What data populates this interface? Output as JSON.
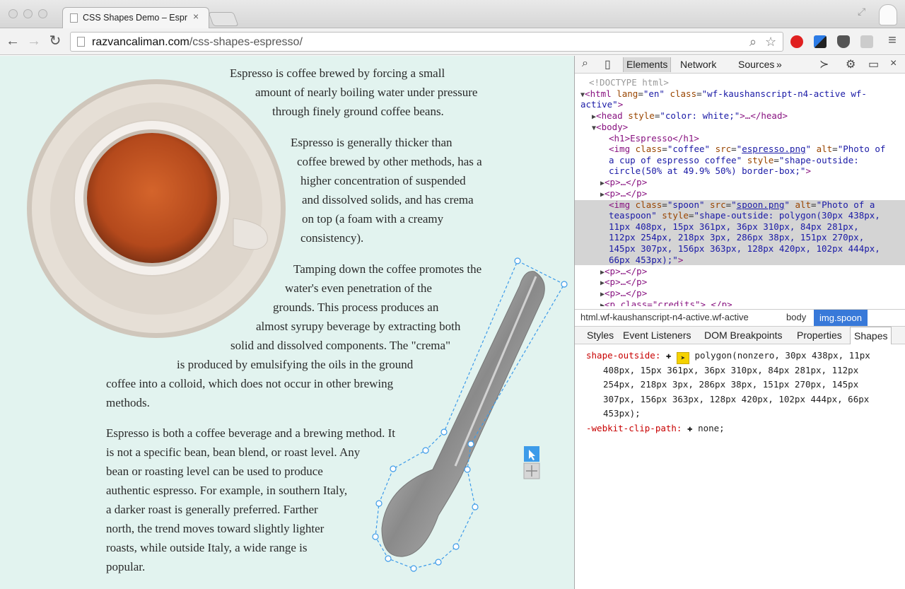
{
  "browser": {
    "tab_title": "CSS Shapes Demo – Espres",
    "tab_close": "×",
    "url_host": "razvancaliman.com",
    "url_path": "/css-shapes-espresso/"
  },
  "article": {
    "paragraphs": [
      [
        "Espresso is coffee brewed by forcing a small",
        "amount of nearly boiling water under pressure",
        "through finely ground coffee beans."
      ],
      [
        "Espresso is generally thicker than",
        "coffee brewed by other methods, has a",
        "higher concentration of suspended",
        "and dissolved solids, and has crema",
        "on top (a foam with a creamy",
        "consistency)."
      ],
      [
        "Tamping down the coffee promotes the",
        "water's even penetration of the",
        "grounds. This process produces an",
        "almost syrupy beverage by extracting both",
        "solid and dissolved components. The \"crema\"",
        "is produced by emulsifying the oils in the ground",
        "coffee into a colloid, which does not occur in other brewing",
        "methods."
      ],
      [
        "Espresso is both a coffee beverage and a brewing method. It",
        "is not a specific bean, bean blend, or roast level. Any",
        "bean or roasting level can be used to produce",
        "authentic espresso. For example, in southern Italy,",
        "a darker roast is generally preferred. Farther",
        "north, the trend moves toward slightly lighter",
        "roasts, while outside Italy, a wide range is",
        "popular."
      ]
    ]
  },
  "devtools": {
    "tabs": [
      "Elements",
      "Network",
      "Sources",
      "»"
    ],
    "dom": {
      "doctype": "<!DOCTYPE html>",
      "html_open": "html",
      "html_lang_attr": "lang",
      "html_lang_val": "\"en\"",
      "html_class_attr": "class",
      "html_class_val1": "\"wf-kaushanscript-n4-active wf-",
      "html_class_val2": "active\"",
      "head_line_a": "head",
      "head_style_attr": "style",
      "head_style_val": "\"color: white;\"",
      "head_line_b": "…</head>",
      "body": "body",
      "h1": "<h1>Espresso</h1>",
      "img1_tag": "img",
      "img1_class": "\"coffee\"",
      "img1_src": "espresso.png",
      "img1_alt1": "\"Photo of",
      "img1_alt2": "a cup of espresso coffee\"",
      "img1_style1": "\"shape-outside:",
      "img1_style2": "circle(50% at 49.9% 50%) border-box;\"",
      "p_collapsed": "<p>…</p>",
      "img2_tag": "img",
      "img2_class": "\"spoon\"",
      "img2_src": "spoon.png",
      "img2_alt1": "\"Photo of a",
      "img2_alt2": "teaspoon\"",
      "img2_style1": "\"shape-outside: polygon(30px 438px,",
      "img2_style2": "11px 408px, 15px 361px, 36px 310px, 84px 281px,",
      "img2_style3": "112px 254px, 218px 3px, 286px 38px, 151px 270px,",
      "img2_style4": "145px 307px, 156px 363px, 128px 420px, 102px 444px,",
      "img2_style5": "66px 453px);\"",
      "credits": "<p class=\"credits\">…</p>"
    },
    "breadcrumbs": [
      "html.wf-kaushanscript-n4-active.wf-active",
      "body",
      "img.spoon"
    ],
    "panel_tabs": [
      "Styles",
      "Event Listeners",
      "DOM Breakpoints",
      "Properties",
      "Shapes"
    ],
    "shapes": {
      "prop1": "shape-outside:",
      "val1_l1": "polygon(nonzero, 30px 438px, 11px",
      "val1_l2": "408px, 15px 361px, 36px 310px, 84px 281px, 112px",
      "val1_l3": "254px, 218px 3px, 286px 38px, 151px 270px, 145px",
      "val1_l4": "307px, 156px 363px, 128px 420px, 102px 444px, 66px",
      "val1_l5": "453px);",
      "prop2": "-webkit-clip-path:",
      "val2": "none;"
    }
  }
}
